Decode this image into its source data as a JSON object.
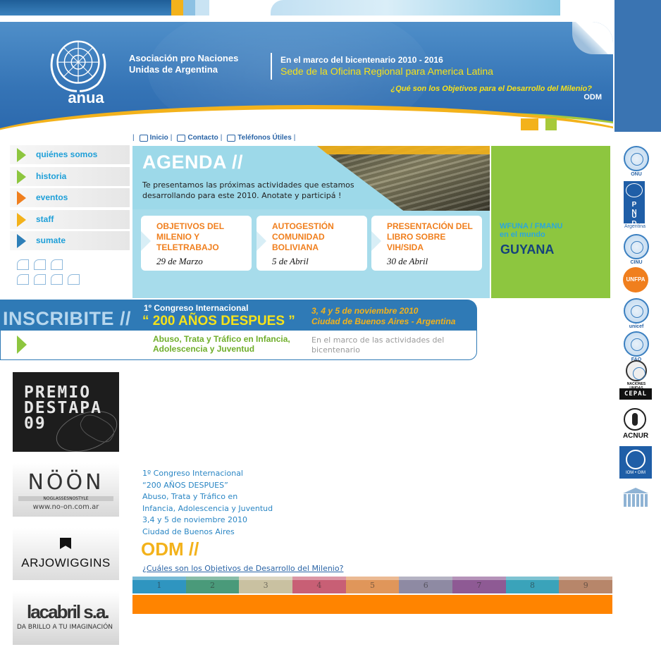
{
  "header": {
    "org_line1": "Asociación pro Naciones",
    "org_line2": "Unidas de Argentina",
    "logo_text": "anua",
    "subtitle1": "En el marco del bicentenario  2010 - 2016",
    "subtitle2": "Sede de la Oficina Regional para America Latina",
    "question": "¿Qué son los Objetivos para el Desarrollo del Milenio?",
    "odm": "ODM"
  },
  "toplinks": {
    "inicio": "Inicio",
    "contacto": "Contacto",
    "telefonos": "Teléfonos Útiles",
    "separator": "|"
  },
  "nav": {
    "items": [
      {
        "label": "quiénes somos",
        "color": "#8dc63f"
      },
      {
        "label": "historia",
        "color": "#8dc63f"
      },
      {
        "label": "eventos",
        "color": "#f07f1e"
      },
      {
        "label": "staff",
        "color": "#f3b21b"
      },
      {
        "label": "sumate",
        "color": "#2e7fb8"
      }
    ]
  },
  "agenda": {
    "title": "AGENDA //",
    "text": "Te presentamos las próximas actividades que estamos desarrollando para este 2010.  Anotate y participá !",
    "cards": [
      {
        "title": "OBJETIVOS DEL MILENIO Y TELETRABAJO",
        "date": "29 de Marzo"
      },
      {
        "title": "AUTOGESTIÓN COMUNIDAD BOLIVIANA",
        "date": "5 de Abril"
      },
      {
        "title": "PRESENTACIÓN DEL LIBRO SOBRE VIH/SIDA",
        "date": "30 de Abril"
      }
    ]
  },
  "wfuna": {
    "line1": "WFUNA / FMANU",
    "line2": "en el mundo",
    "country": "GUYANA"
  },
  "inscribite": {
    "label": "INSCRIBITE //",
    "congress": "1º Congreso Internacional",
    "congress_title": "“ 200 AÑOS DESPUES ”",
    "dates": "3, 4 y 5 de noviembre 2010",
    "place": "Ciudad de Buenos Aires - Argentina",
    "topic": "Abuso, Trata y Tráfico en Infancia, Adolescencia y Juventud",
    "note": "En el marco de las actividades del bicentenario"
  },
  "sponsors": {
    "premio": "PREMIO DESTAPA 09",
    "noon": "NÖÖN",
    "noon_tag": "NOGLASSESNOSTYLE",
    "noon_url": "www.no-on.com.ar",
    "arjo": "ARJOWIGGINS",
    "lacabril": "lacabril s.a.",
    "lacabril_tag": "DA BRILLO A TU IMAGINACIÓN"
  },
  "info": {
    "lines": [
      "1º Congreso Internacional",
      "“200 AÑOS DESPUES”",
      "Abuso, Trata y Tráfico en",
      "Infancia, Adolescencia y Juventud",
      "3,4 y 5 de noviembre 2010",
      "Ciudad de Buenos Aires"
    ]
  },
  "odm": {
    "title": "ODM //",
    "question": "¿Cuáles son los Objetivos de Desarrollo del Milenio?",
    "goals": [
      {
        "n": "1",
        "color": "#2f95c0"
      },
      {
        "n": "2",
        "color": "#4a9a7a"
      },
      {
        "n": "3",
        "color": "#c9c1a1"
      },
      {
        "n": "4",
        "color": "#c85f75"
      },
      {
        "n": "5",
        "color": "#e0965a"
      },
      {
        "n": "6",
        "color": "#8e8aa3"
      },
      {
        "n": "7",
        "color": "#8e5a94"
      },
      {
        "n": "8",
        "color": "#3aa3ba"
      },
      {
        "n": "9",
        "color": "#b7866a"
      }
    ]
  },
  "right_logos": {
    "onu": "ONU",
    "pnud_letters": [
      "P N",
      "U D"
    ],
    "pnud_caption": "Argentina",
    "cinu": "CINU",
    "unfpa": "UNFPA",
    "unicef": "unicef",
    "fao": "FAO",
    "naciones_unidas": "NACIONES UNIDAS",
    "cepal": "CEPAL",
    "acnur": "ACNUR",
    "oim": "IOM • OIM"
  },
  "colors": {
    "brand_blue": "#3574b6",
    "accent_yellow": "#f3b21b",
    "accent_green": "#8dc63f",
    "accent_orange": "#f07f1e"
  }
}
